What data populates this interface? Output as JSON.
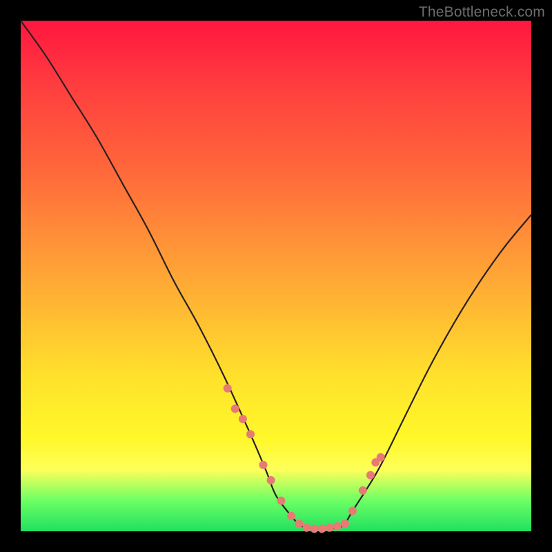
{
  "watermark": "TheBottleneck.com",
  "chart_data": {
    "type": "line",
    "title": "",
    "xlabel": "",
    "ylabel": "",
    "xlim": [
      0,
      100
    ],
    "ylim": [
      0,
      100
    ],
    "grid": false,
    "legend": false,
    "series": [
      {
        "name": "bottleneck-curve",
        "x": [
          0,
          5,
          10,
          15,
          20,
          25,
          30,
          35,
          40,
          45,
          48,
          50,
          53,
          55,
          58,
          60,
          63,
          65,
          70,
          75,
          80,
          85,
          90,
          95,
          100
        ],
        "y": [
          100,
          93,
          85,
          77,
          68,
          59,
          49,
          40,
          30,
          19,
          12,
          7,
          3,
          1,
          0.5,
          0.5,
          1,
          4,
          12,
          22,
          32,
          41,
          49,
          56,
          62
        ]
      }
    ],
    "points": {
      "name": "sample-dots",
      "x": [
        40.5,
        42,
        43.5,
        45,
        47.5,
        49,
        51,
        53,
        54.5,
        56,
        57.5,
        59,
        60.5,
        62,
        63.5,
        65,
        67,
        68.5,
        69.5,
        70.5
      ],
      "y": [
        28,
        24,
        22,
        19,
        13,
        10,
        6,
        3,
        1.5,
        0.7,
        0.5,
        0.5,
        0.7,
        1,
        1.5,
        4,
        8,
        11,
        13.5,
        14.5
      ]
    },
    "background_gradient_stops": [
      {
        "offset": 0.0,
        "color": "#ff163f"
      },
      {
        "offset": 0.3,
        "color": "#ff6a3a"
      },
      {
        "offset": 0.7,
        "color": "#ffe22b"
      },
      {
        "offset": 0.88,
        "color": "#fdff5a"
      },
      {
        "offset": 1.0,
        "color": "#20e060"
      }
    ]
  }
}
